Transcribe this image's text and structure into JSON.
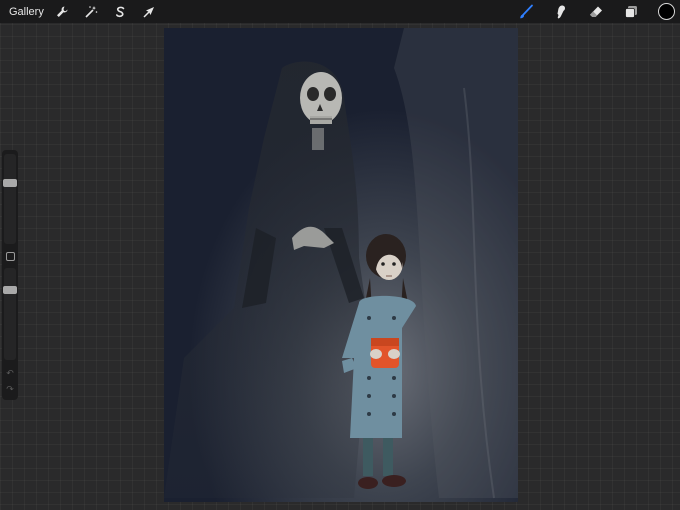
{
  "toolbar": {
    "gallery_label": "Gallery",
    "left_icons": [
      "wrench-icon",
      "magic-wand-icon",
      "selection-s-icon",
      "transform-arrow-icon"
    ],
    "right_icons": [
      "brush-icon",
      "smudge-icon",
      "eraser-icon",
      "layers-icon"
    ],
    "active_tool": "brush",
    "active_color": "#000000",
    "accent_color": "#2f7fff"
  },
  "sidebar": {
    "brush_size_level": 0.3,
    "opacity_level": 0.22
  },
  "artwork": {
    "background_color": "#1f2530",
    "book_color": "#e2542a",
    "coat_color": "#6f8fa0"
  }
}
